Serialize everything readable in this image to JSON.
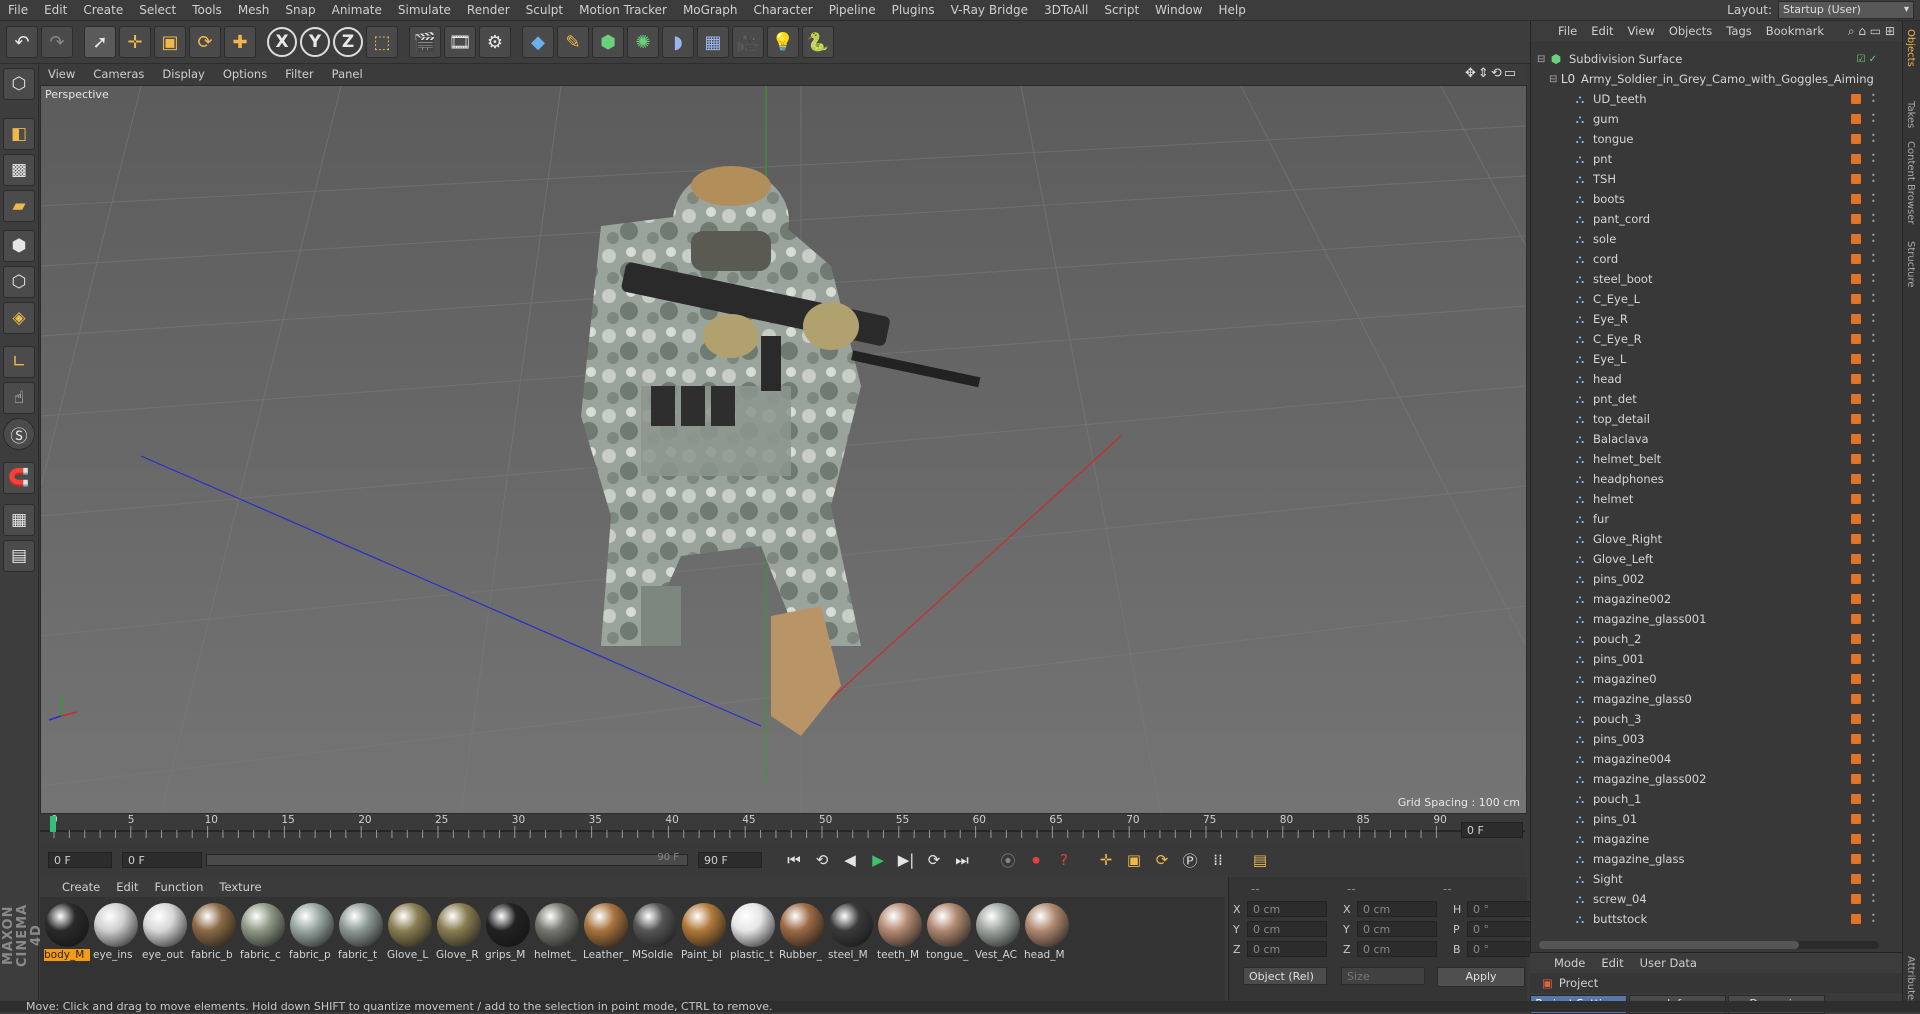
{
  "menubar": {
    "items": [
      "File",
      "Edit",
      "Create",
      "Select",
      "Tools",
      "Mesh",
      "Snap",
      "Animate",
      "Simulate",
      "Render",
      "Sculpt",
      "Motion Tracker",
      "MoGraph",
      "Character",
      "Pipeline",
      "Plugins",
      "V-Ray Bridge",
      "3DToAll",
      "Script",
      "Window",
      "Help"
    ],
    "layout_label": "Layout:",
    "layout_value": "Startup (User)"
  },
  "toolbar": {
    "icons": [
      "undo-icon",
      "redo-icon",
      "select-arrow-icon",
      "move-icon",
      "scale-icon",
      "rotate-icon",
      "recent-tool-icon",
      "x-axis-icon",
      "y-axis-icon",
      "z-axis-icon",
      "coordinate-system-icon",
      "render-view-icon",
      "render-picture-viewer-icon",
      "render-settings-icon",
      "cube-icon",
      "pen-icon",
      "subdivision-icon",
      "array-icon",
      "deformer-icon",
      "floor-icon",
      "camera-icon",
      "light-icon",
      "python-icon"
    ],
    "axis_x": "X",
    "axis_y": "Y",
    "axis_z": "Z"
  },
  "viewport": {
    "menu": [
      "View",
      "Cameras",
      "Display",
      "Options",
      "Filter",
      "Panel"
    ],
    "label": "Perspective",
    "grid_spacing": "Grid Spacing : 100 cm"
  },
  "timeline": {
    "ticks": [
      "0",
      "5",
      "10",
      "15",
      "20",
      "25",
      "30",
      "35",
      "40",
      "45",
      "50",
      "55",
      "60",
      "65",
      "70",
      "75",
      "80",
      "85",
      "90"
    ],
    "current_frame": "0 F",
    "start_field": "0 F",
    "range_start": "0 F",
    "range_end": "90 F",
    "end_field": "90 F",
    "frame_display": "0 F"
  },
  "materials": {
    "menu": [
      "Create",
      "Edit",
      "Function",
      "Texture"
    ],
    "items": [
      {
        "label": "body_M",
        "color": "#2a2a2a"
      },
      {
        "label": "eye_ins",
        "color": "#cfcfcf"
      },
      {
        "label": "eye_out",
        "color": "#d8d8d8"
      },
      {
        "label": "fabric_b",
        "color": "#8a6a44"
      },
      {
        "label": "fabric_c",
        "color": "#8f9a86"
      },
      {
        "label": "fabric_p",
        "color": "#9aa8a2"
      },
      {
        "label": "fabric_t",
        "color": "#8e9a96"
      },
      {
        "label": "Glove_L",
        "color": "#8a7e52"
      },
      {
        "label": "Glove_R",
        "color": "#8a7e52"
      },
      {
        "label": "grips_M",
        "color": "#222222"
      },
      {
        "label": "helmet_",
        "color": "#777770"
      },
      {
        "label": "Leather_",
        "color": "#a8743e"
      },
      {
        "label": "MSoldie",
        "color": "#555555"
      },
      {
        "label": "Paint_bl",
        "color": "#b07a3a"
      },
      {
        "label": "plastic_t",
        "color": "#e6e6e6"
      },
      {
        "label": "Rubber_",
        "color": "#9c6a44"
      },
      {
        "label": "steel_M",
        "color": "#3a3a3a"
      },
      {
        "label": "teeth_M",
        "color": "#b48a72"
      },
      {
        "label": "tongue_",
        "color": "#b08870"
      },
      {
        "label": "Vest_AC",
        "color": "#9ea6a0"
      },
      {
        "label": "head_M",
        "color": "#b08a72"
      }
    ]
  },
  "coords": {
    "header": [
      "--",
      "--",
      "--"
    ],
    "rows": [
      {
        "a": "X",
        "av": "0 cm",
        "b": "X",
        "bv": "0 cm",
        "c": "H",
        "cv": "0 °"
      },
      {
        "a": "Y",
        "av": "0 cm",
        "b": "Y",
        "bv": "0 cm",
        "c": "P",
        "cv": "0 °"
      },
      {
        "a": "Z",
        "av": "0 cm",
        "b": "Z",
        "bv": "0 cm",
        "c": "B",
        "cv": "0 °"
      }
    ],
    "mode": "Object (Rel)",
    "size": "Size",
    "apply": "Apply"
  },
  "objects": {
    "menu": [
      "File",
      "Edit",
      "View",
      "Objects",
      "Tags",
      "Bookmark"
    ],
    "root": "Subdivision Surface",
    "child": "Army_Soldier_in_Grey_Camo_with_Goggles_Aiming",
    "items": [
      "UD_teeth",
      "gum",
      "tongue",
      "pnt",
      "TSH",
      "boots",
      "pant_cord",
      "sole",
      "cord",
      "steel_boot",
      "C_Eye_L",
      "Eye_R",
      "C_Eye_R",
      "Eye_L",
      "head",
      "pnt_det",
      "top_detail",
      "Balaclava",
      "helmet_belt",
      "headphones",
      "helmet",
      "fur",
      "Glove_Right",
      "Glove_Left",
      "pins_002",
      "magazine002",
      "magazine_glass001",
      "pouch_2",
      "pins_001",
      "magazine0",
      "magazine_glass0",
      "pouch_3",
      "pins_003",
      "magazine004",
      "magazine_glass002",
      "pouch_1",
      "pins_01",
      "magazine",
      "magazine_glass",
      "Sight",
      "screw_04",
      "buttstock"
    ]
  },
  "attributes": {
    "menu": [
      "Mode",
      "Edit",
      "User Data"
    ],
    "project": "Project",
    "tabs": [
      "Project Settings",
      "Info",
      "Dynamics"
    ]
  },
  "right_tabs": [
    "Objects",
    "Takes",
    "Content Browser",
    "Structure",
    "Attributes"
  ],
  "status": "Move: Click and drag to move elements. Hold down SHIFT to quantize movement / add to the selection in point mode, CTRL to remove.",
  "brand": "MAXON CINEMA 4D"
}
